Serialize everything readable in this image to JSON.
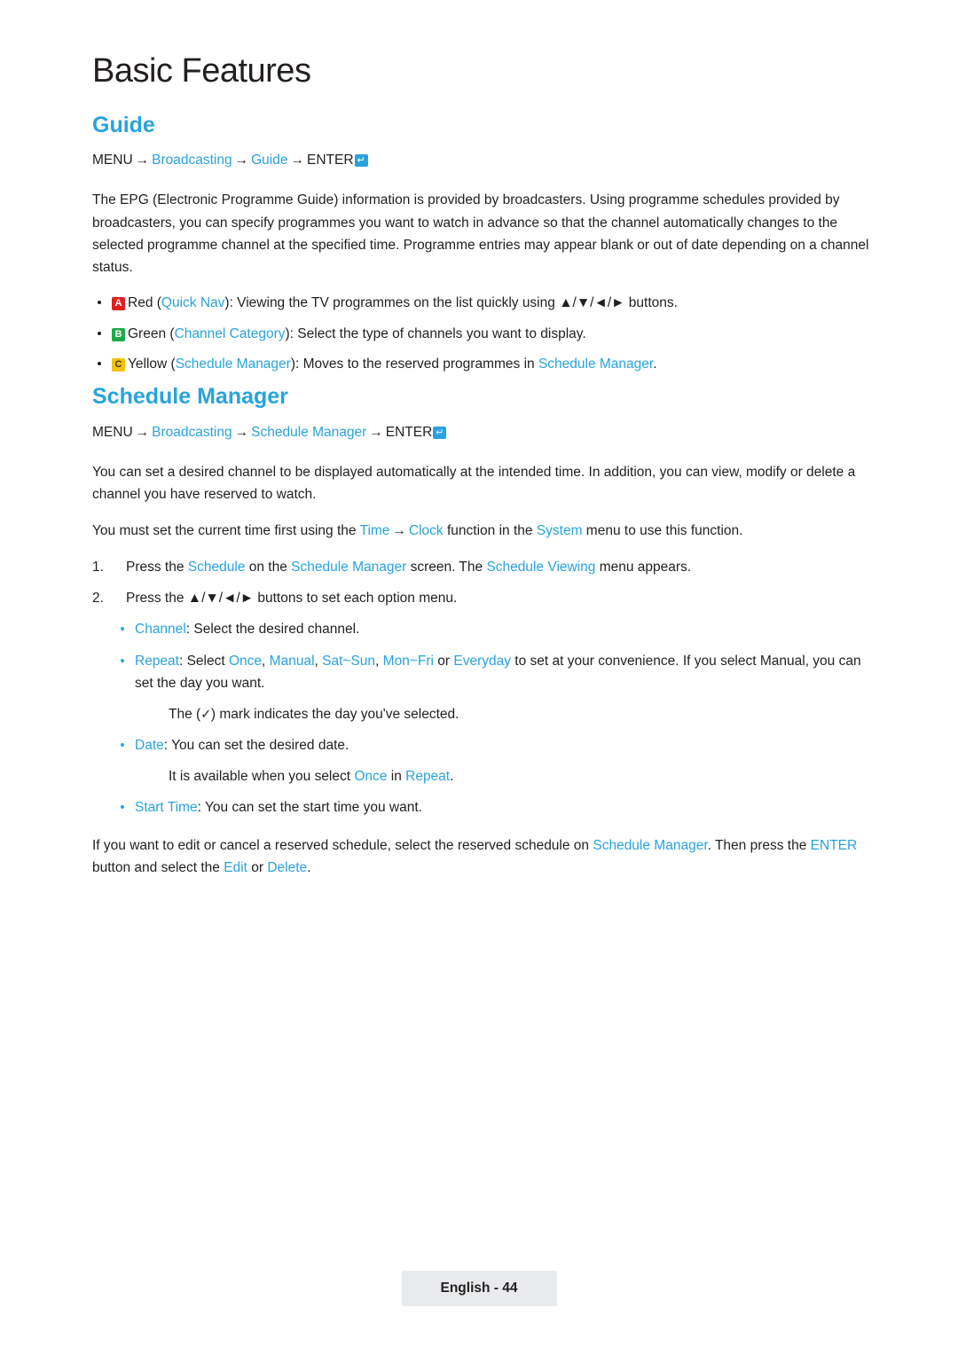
{
  "page": {
    "chapter_title": "Basic Features",
    "footer_label": "English - 44"
  },
  "guide": {
    "heading": "Guide",
    "menu_path": {
      "root": "MENU",
      "item1": "Broadcasting",
      "item2": "Guide",
      "enter": "ENTER",
      "enter_glyph": "↵",
      "arrow": "→"
    },
    "intro": "The EPG (Electronic Programme Guide) information is provided by broadcasters. Using programme schedules provided by broadcasters, you can specify programmes you want to watch in advance so that the channel automatically changes to the selected programme channel at the specified time. Programme entries may appear blank or out of date depending on a channel status.",
    "bullets": [
      {
        "key": "A",
        "key_color": "red",
        "color_word": "Red",
        "feature": "Quick Nav",
        "text_before": " (",
        "text_after": "): Viewing the TV programmes on the list quickly using ",
        "buttons": "▲/▼/◄/►",
        "text_end": " buttons."
      },
      {
        "key": "B",
        "key_color": "green",
        "color_word": "Green",
        "feature": "Channel Category",
        "text_before": " (",
        "text_after": "): Select the type of channels you want to display."
      },
      {
        "key": "C",
        "key_color": "yellow",
        "color_word": "Yellow",
        "feature": "Schedule Manager",
        "text_before": " (",
        "text_after": "): Moves to the reserved programmes in ",
        "feature2": "Schedule Manager",
        "text_end": "."
      }
    ]
  },
  "schedule_manager": {
    "heading": "Schedule Manager",
    "menu_path": {
      "root": "MENU",
      "item1": "Broadcasting",
      "item2": "Schedule Manager",
      "enter": "ENTER",
      "enter_glyph": "↵",
      "arrow": "→"
    },
    "intro": "You can set a desired channel to be displayed automatically at the intended time. In addition, you can view, modify or delete a channel you have reserved to watch.",
    "note": {
      "before": "You must set the current time first using the ",
      "time": "Time",
      "arrow": "→",
      "clock": "Clock",
      "middle": " function in the ",
      "system": "System",
      "after": " menu to use this function."
    },
    "steps": [
      {
        "num": "1.",
        "before": "Press the ",
        "link1": "Schedule",
        "mid1": " on the ",
        "link2": "Schedule Manager",
        "mid2": " screen. The ",
        "link3": "Schedule Viewing",
        "after": " menu appears."
      },
      {
        "num": "2.",
        "before": "Press the ",
        "buttons": "▲/▼/◄/►",
        "after": " buttons to set each option menu."
      }
    ],
    "options": [
      {
        "label": "Channel",
        "text": ": Select the desired channel."
      },
      {
        "label": "Repeat",
        "text_before": ": Select ",
        "values": [
          "Once",
          "Manual",
          "Sat~Sun",
          "Mon~Fri"
        ],
        "or_word": " or ",
        "value_last": "Everyday",
        "text_after": " to set at your convenience. If you select Manual, you can set the day you want.",
        "subnote_before": "The (",
        "subnote_mark": "✓",
        "subnote_after": ") mark indicates the day you've selected."
      },
      {
        "label": "Date",
        "text": ": You can set the desired date.",
        "subnote_before": "It is available when you select ",
        "subnote_link1": "Once",
        "subnote_mid": " in ",
        "subnote_link2": "Repeat",
        "subnote_after": "."
      },
      {
        "label": "Start Time",
        "text": ": You can set the start time you want."
      }
    ],
    "closing": {
      "before": "If you want to edit or cancel a reserved schedule, select the reserved schedule on ",
      "link1": "Schedule Manager",
      "mid1": ". Then press the ",
      "link2": "ENTER",
      "mid2": " button and select the ",
      "link3": "Edit",
      "mid3": " or ",
      "link4": "Delete",
      "after": "."
    }
  }
}
